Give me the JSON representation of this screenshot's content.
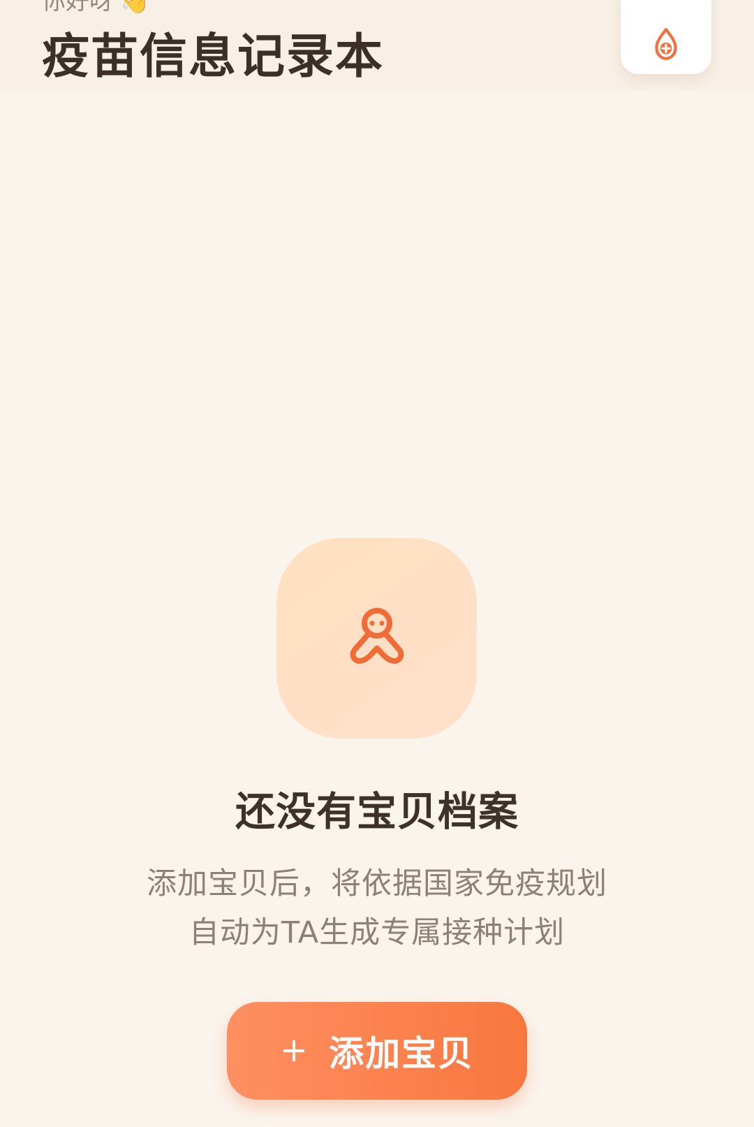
{
  "header": {
    "greeting": "你好呀",
    "greeting_icon": "waving-hand-icon",
    "title": "疫苗信息记录本",
    "action_icon": "vaccine-drop-icon"
  },
  "empty_state": {
    "icon": "baby-icon",
    "title": "还没有宝贝档案",
    "description_line_1": "添加宝贝后，将依据国家免疫规划",
    "description_line_2": "自动为TA生成专属接种计划",
    "button_label": "添加宝贝",
    "button_icon": "plus-icon"
  },
  "colors": {
    "background": "#fbf4ec",
    "accent": "#f47a45",
    "title": "#3b2f28",
    "muted_text": "#8d8176"
  }
}
